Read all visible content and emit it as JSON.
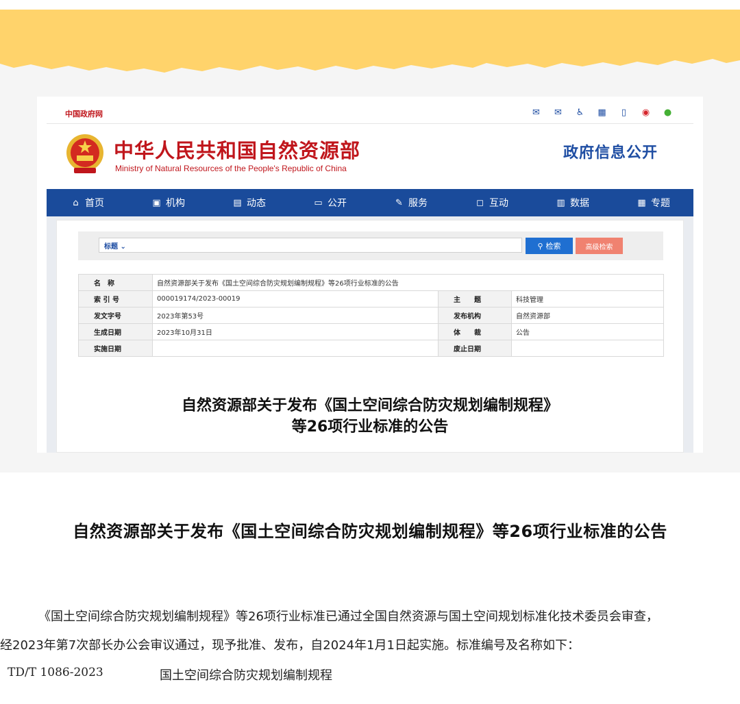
{
  "site": {
    "gov_link": "中国政府网",
    "ministry_cn": "中华人民共和国自然资源部",
    "ministry_en": "Ministry of Natural Resources of the People's Republic of China",
    "gov_open": "政府信息公开",
    "tool_icons": [
      "mail-icon",
      "mail-feedback-icon",
      "accessibility-icon",
      "app-icon",
      "mobile-icon",
      "weibo-icon",
      "wechat-icon"
    ],
    "colors": {
      "brand_red": "#c0161c",
      "nav_blue": "#1a4b9b",
      "banner_yellow": "#ffd36b"
    }
  },
  "nav": {
    "items": [
      {
        "label": "首页",
        "icon": "home-icon"
      },
      {
        "label": "机构",
        "icon": "org-icon"
      },
      {
        "label": "动态",
        "icon": "book-icon"
      },
      {
        "label": "公开",
        "icon": "monitor-icon"
      },
      {
        "label": "服务",
        "icon": "edit-icon"
      },
      {
        "label": "互动",
        "icon": "chat-icon"
      },
      {
        "label": "数据",
        "icon": "bar-chart-icon"
      },
      {
        "label": "专题",
        "icon": "doc-icon"
      }
    ]
  },
  "search": {
    "type_label": "标题",
    "search_label": "检索",
    "advanced_label": "高级检索"
  },
  "meta": {
    "name_key": "名　称",
    "name_value": "自然资源部关于发布《国土空间综合防灾规划编制规程》等26项行业标准的公告",
    "rows": [
      {
        "k1": "索 引 号",
        "v1": "000019174/2023-00019",
        "k2": "主　　题",
        "v2": "科技管理"
      },
      {
        "k1": "发文字号",
        "v1": "2023年第53号",
        "k2": "发布机构",
        "v2": "自然资源部"
      },
      {
        "k1": "生成日期",
        "v1": "2023年10月31日",
        "k2": "体　　裁",
        "v2": "公告"
      },
      {
        "k1": "实施日期",
        "v1": "",
        "k2": "废止日期",
        "v2": ""
      }
    ]
  },
  "doc_title_line1": "自然资源部关于发布《国土空间综合防灾规划编制规程》",
  "doc_title_line2": "等26项行业标准的公告",
  "article": {
    "title": "自然资源部关于发布《国土空间综合防灾规划编制规程》等26项行业标准的公告",
    "para_line1": "《国土空间综合防灾规划编制规程》等26项行业标准已通过全国自然资源与国土空间规划标准化技术委员会审查，",
    "para_line2": "经2023年第7次部长办公会审议通过，现予批准、发布，自2024年1月1日起实施。标准编号及名称如下：",
    "std_code": "TD/T 1086-2023",
    "std_name": "国土空间综合防灾规划编制规程"
  }
}
